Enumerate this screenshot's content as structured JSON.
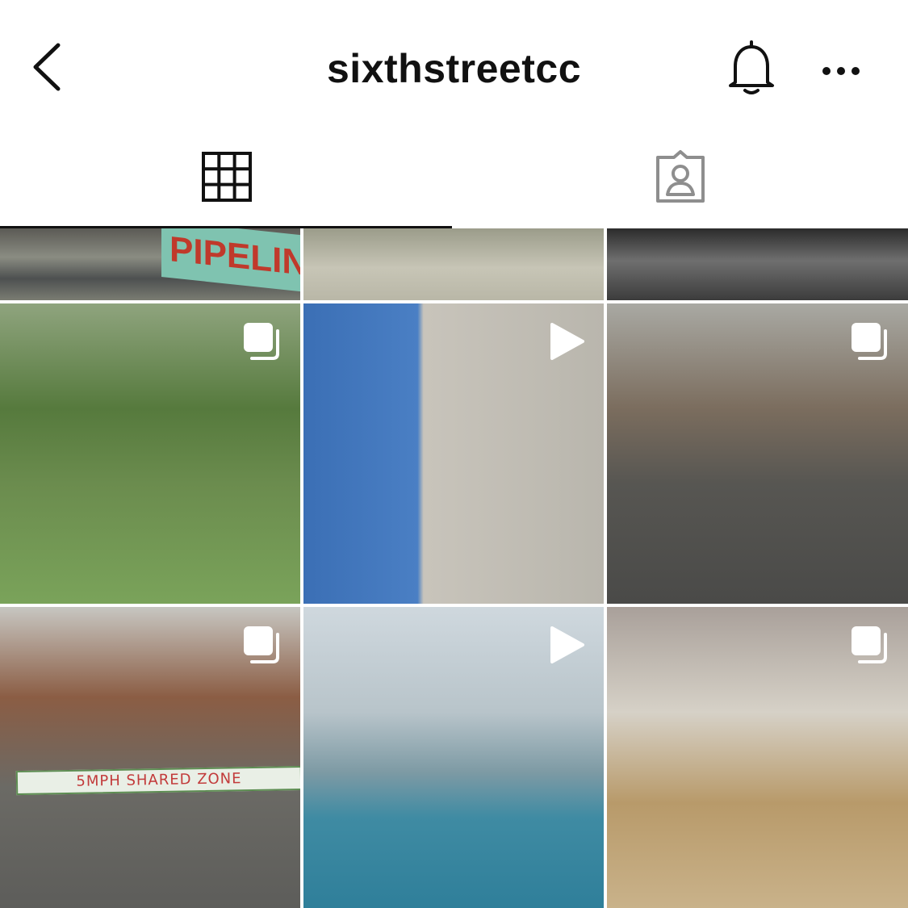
{
  "header": {
    "username": "sixthstreetcc",
    "back_icon": "chevron-left-icon",
    "bell_icon": "bell-icon",
    "more_icon": "more-horizontal-icon"
  },
  "tabs": [
    {
      "name": "grid",
      "icon": "grid-icon",
      "selected": true
    },
    {
      "name": "tagged",
      "icon": "tagged-person-icon",
      "selected": false
    }
  ],
  "photos": [
    {
      "id": "r0c0",
      "badge": "none",
      "text": "PIPELIN"
    },
    {
      "id": "r0c1",
      "badge": "none"
    },
    {
      "id": "r0c2",
      "badge": "none"
    },
    {
      "id": "r1c0",
      "badge": "carousel-icon"
    },
    {
      "id": "r1c1",
      "badge": "play-icon"
    },
    {
      "id": "r1c2",
      "badge": "carousel-icon"
    },
    {
      "id": "r2c0",
      "badge": "carousel-icon",
      "text": "5MPH SHARED ZONE"
    },
    {
      "id": "r2c1",
      "badge": "play-icon"
    },
    {
      "id": "r2c2",
      "badge": "carousel-icon"
    }
  ],
  "colors": {
    "text": "#111111",
    "icon": "#111111",
    "inactive_tab_icon": "#8e8e8e",
    "background": "#ffffff"
  }
}
